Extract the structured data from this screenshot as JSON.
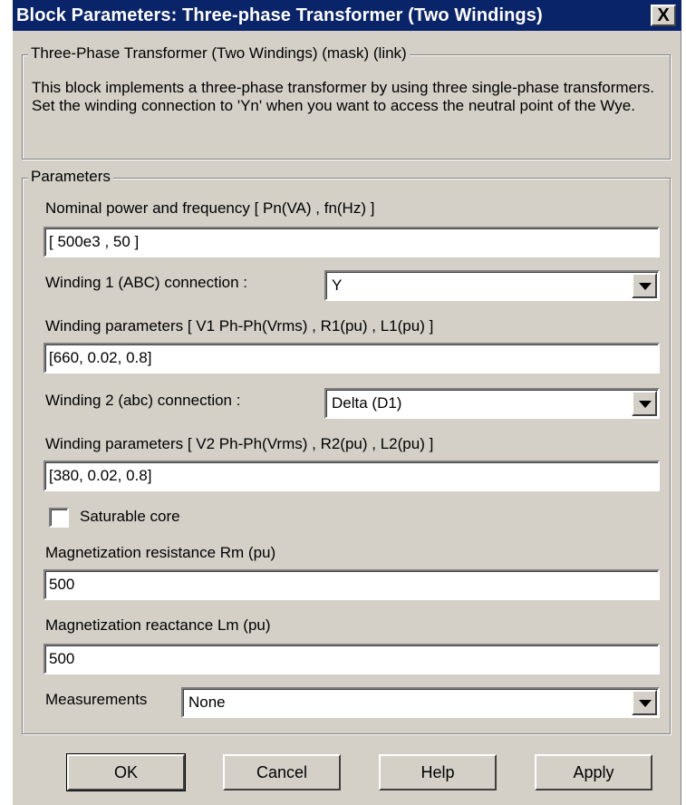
{
  "window": {
    "title": "Block Parameters: Three-phase Transformer (Two Windings)",
    "close_label": "X"
  },
  "description_group": {
    "legend": "Three-Phase Transformer (Two Windings) (mask) (link)",
    "text": "This block implements a three-phase transformer by using three single-phase transformers. Set the winding connection to 'Yn'  when you want to access the neutral point of the Wye."
  },
  "parameters": {
    "legend": "Parameters",
    "nominal_label": "Nominal power and frequency  [ Pn(VA) , fn(Hz) ]",
    "nominal_value": "[ 500e3 , 50 ]",
    "winding1_conn_label": "Winding 1 (ABC) connection :",
    "winding1_conn_value": "Y",
    "winding1_params_label": "Winding parameters [ V1 Ph-Ph(Vrms) , R1(pu) , L1(pu) ]",
    "winding1_params_value": "[660, 0.02, 0.8]",
    "winding2_conn_label": "Winding 2 (abc) connection :",
    "winding2_conn_value": "Delta (D1)",
    "winding2_params_label": "Winding parameters [ V2 Ph-Ph(Vrms) , R2(pu) , L2(pu) ]",
    "winding2_params_value": "[380, 0.02, 0.8]",
    "saturable_label": "Saturable core",
    "saturable_checked": false,
    "rm_label": "Magnetization resistance  Rm (pu)",
    "rm_value": "500",
    "lm_label": "Magnetization reactance Lm (pu)",
    "lm_value": "500",
    "measurements_label": "Measurements",
    "measurements_value": "None"
  },
  "buttons": {
    "ok": "OK",
    "cancel": "Cancel",
    "help": "Help",
    "apply": "Apply"
  }
}
